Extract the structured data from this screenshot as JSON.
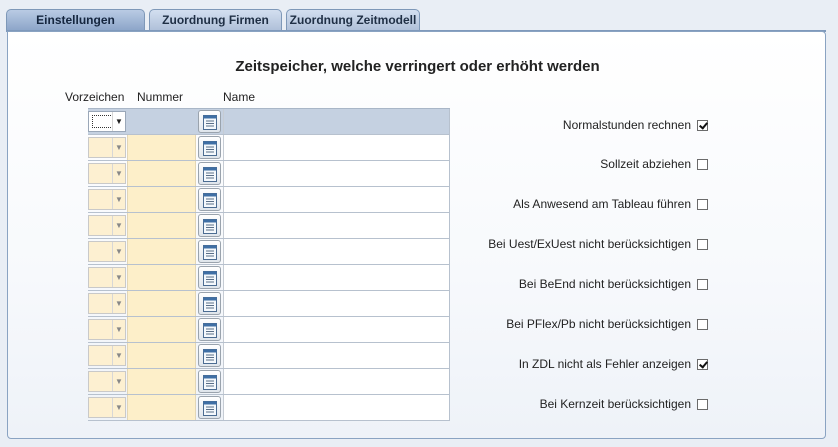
{
  "tabs": [
    {
      "label": "Einstellungen",
      "active": true
    },
    {
      "label": "Zuordnung Firmen",
      "active": false
    },
    {
      "label": "Zuordnung Zeitmodell",
      "active": false
    }
  ],
  "section_title": "Zeitspeicher, welche verringert oder erhöht werden",
  "columns": {
    "sign": "Vorzeichen",
    "number": "Nummer",
    "name": "Name"
  },
  "grid_rows": [
    {
      "sign": "",
      "number": "",
      "name": "",
      "selected": true
    },
    {
      "sign": "",
      "number": "",
      "name": ""
    },
    {
      "sign": "",
      "number": "",
      "name": ""
    },
    {
      "sign": "",
      "number": "",
      "name": ""
    },
    {
      "sign": "",
      "number": "",
      "name": ""
    },
    {
      "sign": "",
      "number": "",
      "name": ""
    },
    {
      "sign": "",
      "number": "",
      "name": ""
    },
    {
      "sign": "",
      "number": "",
      "name": ""
    },
    {
      "sign": "",
      "number": "",
      "name": ""
    },
    {
      "sign": "",
      "number": "",
      "name": ""
    },
    {
      "sign": "",
      "number": "",
      "name": ""
    },
    {
      "sign": "",
      "number": "",
      "name": ""
    }
  ],
  "options": [
    {
      "label": "Normalstunden rechnen",
      "checked": true
    },
    {
      "label": "Sollzeit abziehen",
      "checked": false
    },
    {
      "label": "Als Anwesend am Tableau führen",
      "checked": false
    },
    {
      "label": "Bei Uest/ExUest nicht berücksichtigen",
      "checked": false
    },
    {
      "label": "Bei BeEnd nicht berücksichtigen",
      "checked": false
    },
    {
      "label": "Bei PFlex/Pb nicht berücksichtigen",
      "checked": false
    },
    {
      "label": "In ZDL nicht als Fehler anzeigen",
      "checked": true
    },
    {
      "label": "Bei Kernzeit berücksichtigen",
      "checked": false
    }
  ],
  "icons": {
    "dropdown": "chevron-down-icon",
    "lookup": "list-picker-icon"
  }
}
